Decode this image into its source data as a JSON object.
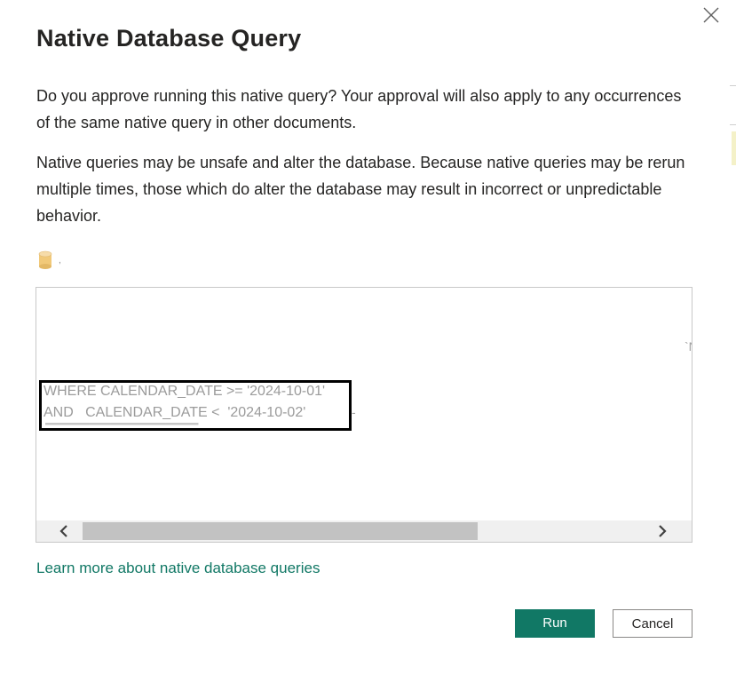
{
  "dialog": {
    "title": "Native Database Query",
    "paragraph1": "Do you approve running this native query? Your approval will also apply to any occurrences of the same native query in other documents.",
    "paragraph2": "Native queries may be unsafe and alter the database. Because native queries may be rerun multiple times, those which do alter the database may result in incorrect or unpredictable behavior.",
    "database_icon": "database-icon",
    "database_label": ","
  },
  "query": {
    "line1": "WHERE CALENDAR_DATE >= '2024-10-01'",
    "line2": "AND   CALENDAR_DATE <  '2024-10-02'"
  },
  "footer": {
    "learn_more": "Learn more about native database queries",
    "run_label": "Run",
    "cancel_label": "Cancel"
  },
  "colors": {
    "accent": "#117865",
    "text": "#252423",
    "query_text": "#9b9b9b"
  }
}
